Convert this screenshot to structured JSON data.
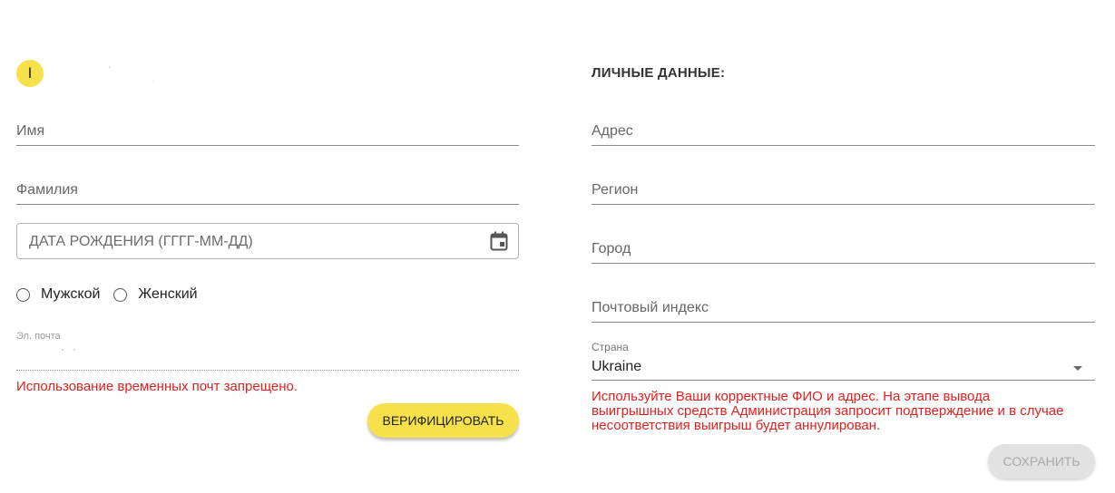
{
  "profile": {
    "avatar_letter": "I"
  },
  "left_form": {
    "first_name_placeholder": "Имя",
    "last_name_placeholder": "Фамилия",
    "birth_date_placeholder": "ДАТА РОЖДЕНИЯ (ГГГГ-ММ-ДД)",
    "gender_options": [
      "Мужской",
      "Женский"
    ],
    "email_label": "Эл. почта",
    "email_error": "Использование временных почт запрещено.",
    "verify_label": "ВЕРИФИЦИРОВАТЬ"
  },
  "right_form": {
    "title": "ЛИЧНЫЕ ДАННЫЕ:",
    "address_placeholder": "Адрес",
    "region_placeholder": "Регион",
    "city_placeholder": "Город",
    "postal_placeholder": "Почтовый индекс",
    "country_label": "Страна",
    "country_value": "Ukraine",
    "notice": "Используйте Ваши корректные ФИО и адрес. На этапе вывода выигрышных средств Администрация запросит подтверждение и в случае несоответствия выигрыш будет аннулирован.",
    "save_label": "СОХРАНИТЬ"
  },
  "colors": {
    "accent": "#f7e14a",
    "error": "#e0201e",
    "disabled_button": "#e2e2e2"
  },
  "icons": {
    "date_field": "calendar-icon",
    "country_select": "dropdown-arrow-icon"
  }
}
